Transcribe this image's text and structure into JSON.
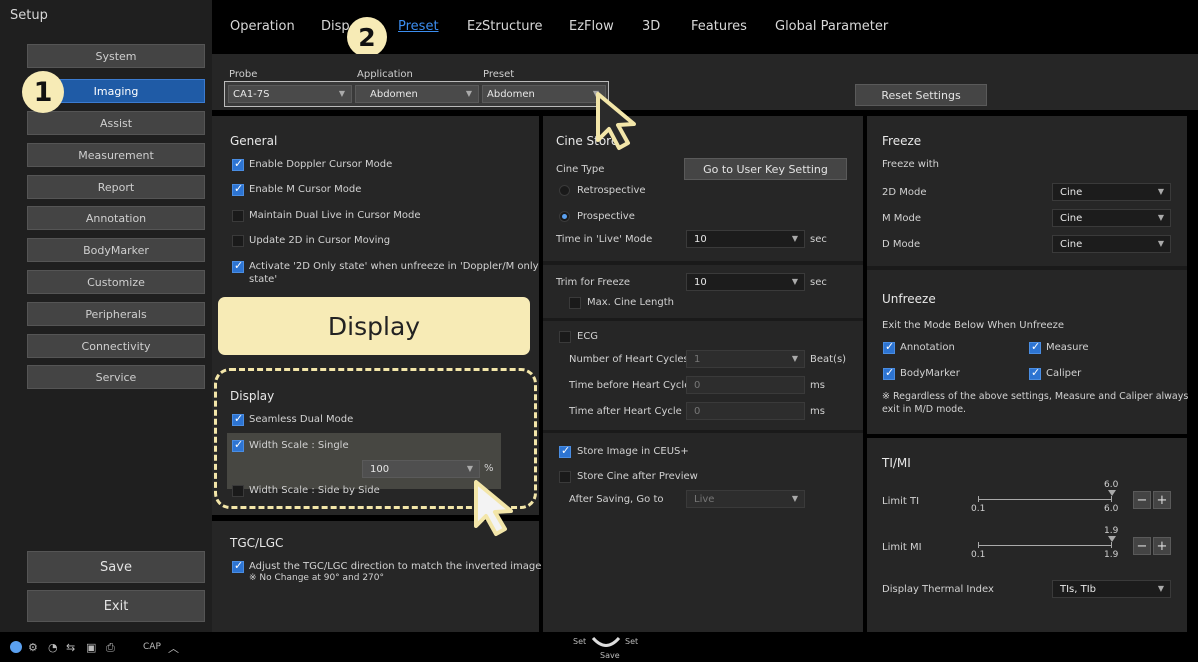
{
  "sidebar": {
    "title": "Setup",
    "items": [
      "System",
      "Imaging",
      "Assist",
      "Measurement",
      "Report",
      "Annotation",
      "BodyMarker",
      "Customize",
      "Peripherals",
      "Connectivity",
      "Service"
    ],
    "active": "Imaging",
    "save_label": "Save",
    "exit_label": "Exit"
  },
  "badges": {
    "one": "1",
    "two": "2"
  },
  "tabs": [
    "Operation",
    "Disp",
    "Preset",
    "EzStructure",
    "EzFlow",
    "3D",
    "Features",
    "Global Parameter"
  ],
  "probe_row": {
    "probe_label": "Probe",
    "probe_value": "CA1-7S",
    "application_label": "Application",
    "application_value": "Abdomen",
    "preset_label": "Preset",
    "preset_value": "Abdomen",
    "reset_label": "Reset Settings"
  },
  "general": {
    "title": "General",
    "items": [
      {
        "label": "Enable Doppler Cursor Mode",
        "checked": true
      },
      {
        "label": "Enable M Cursor Mode",
        "checked": true
      },
      {
        "label": "Maintain Dual Live in Cursor Mode",
        "checked": false
      },
      {
        "label": "Update 2D in Cursor Moving",
        "checked": false
      },
      {
        "label": "Activate '2D Only state' when unfreeze in 'Doppler/M only",
        "checked": true
      }
    ],
    "wrap_line": "state'"
  },
  "callout": "Display",
  "display": {
    "title": "Display",
    "seamless": "Seamless Dual Mode",
    "width_single": "Width Scale : Single",
    "width_value": "100",
    "percent": "%",
    "width_side": "Width Scale : Side by Side"
  },
  "tgc": {
    "title": "TGC/LGC",
    "item": "Adjust the TGC/LGC direction to match the inverted image",
    "note": "※ No Change at 90° and 270°"
  },
  "cine": {
    "title": "Cine Store",
    "type_label": "Cine Type",
    "go_button": "Go to User Key Setting",
    "retro": "Retrospective",
    "prosp": "Prospective",
    "time_live_label": "Time in 'Live' Mode",
    "time_live_value": "10",
    "sec": "sec",
    "trim_label": "Trim for Freeze",
    "trim_value": "10",
    "max_cine": "Max. Cine Length",
    "ecg": "ECG",
    "heart_cycles": "Number of Heart Cycles",
    "heart_cycles_value": "1",
    "beats": "Beat(s)",
    "before_label": "Time before Heart Cycle",
    "before_value": "0",
    "after_label": "Time after Heart Cycle",
    "after_value": "0",
    "ms": "ms",
    "store_ceus": "Store Image in CEUS+",
    "store_cine": "Store Cine after Preview",
    "after_saving": "After Saving, Go to",
    "after_saving_value": "Live"
  },
  "freeze": {
    "title": "Freeze",
    "with": "Freeze with",
    "rows": [
      {
        "label": "2D Mode",
        "value": "Cine"
      },
      {
        "label": "M Mode",
        "value": "Cine"
      },
      {
        "label": "D Mode",
        "value": "Cine"
      }
    ]
  },
  "unfreeze": {
    "title": "Unfreeze",
    "sub": "Exit the Mode Below When Unfreeze",
    "annotation": "Annotation",
    "measure": "Measure",
    "bodymarker": "BodyMarker",
    "caliper": "Caliper",
    "note1": "※ Regardless of the above settings, Measure and Caliper always",
    "note2": "exit in M/D mode."
  },
  "timi": {
    "title": "TI/MI",
    "limit_ti": "Limit TI",
    "ti_min": "0.1",
    "ti_max": "6.0",
    "ti_cur": "6.0",
    "limit_mi": "Limit MI",
    "mi_min": "0.1",
    "mi_max": "1.9",
    "mi_cur": "1.9",
    "thermal_label": "Display Thermal Index",
    "thermal_value": "TIs, TIb",
    "minus": "−",
    "plus": "+"
  },
  "status": {
    "cap": "CAP",
    "set_left": "Set",
    "set_right": "Set",
    "save": "Save"
  }
}
